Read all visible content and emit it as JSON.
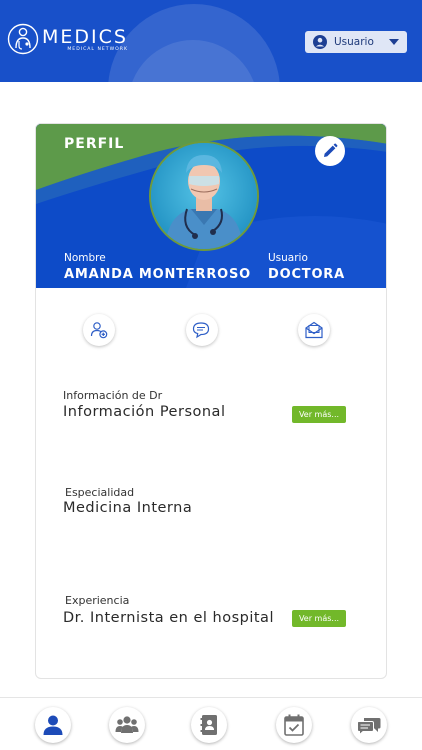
{
  "app": {
    "logo_main": "MEDICS",
    "logo_sub": "MEDICAL NETWORK",
    "user_dropdown_label": "Usuario"
  },
  "colors": {
    "header_blue": "#1850c9",
    "banner_blue": "#0d4bc8",
    "banner_green": "#5d9a4a",
    "accent_green": "#72b82a",
    "icon_blue": "#1d4bb8"
  },
  "profile": {
    "section_title": "PERFIL",
    "name_label": "Nombre",
    "name_value": "AMANDA MONTERROSO",
    "user_label": "Usuario",
    "user_value": "DOCTORA"
  },
  "actions": [
    {
      "icon": "add-user-icon"
    },
    {
      "icon": "chat-icon"
    },
    {
      "icon": "mail-icon"
    }
  ],
  "sections": [
    {
      "label": "Información de Dr",
      "value": "Información Personal",
      "button": "Ver más..."
    },
    {
      "label": "Especialidad",
      "value": "Medicina Interna"
    },
    {
      "label": "Experiencia",
      "value": "Dr. Internista en el hospital",
      "button": "Ver más..."
    }
  ],
  "bottom_nav": [
    {
      "icon": "user-icon",
      "active": true
    },
    {
      "icon": "group-icon",
      "active": false
    },
    {
      "icon": "contacts-book-icon",
      "active": false
    },
    {
      "icon": "calendar-check-icon",
      "active": false
    },
    {
      "icon": "messages-icon",
      "active": false
    }
  ]
}
